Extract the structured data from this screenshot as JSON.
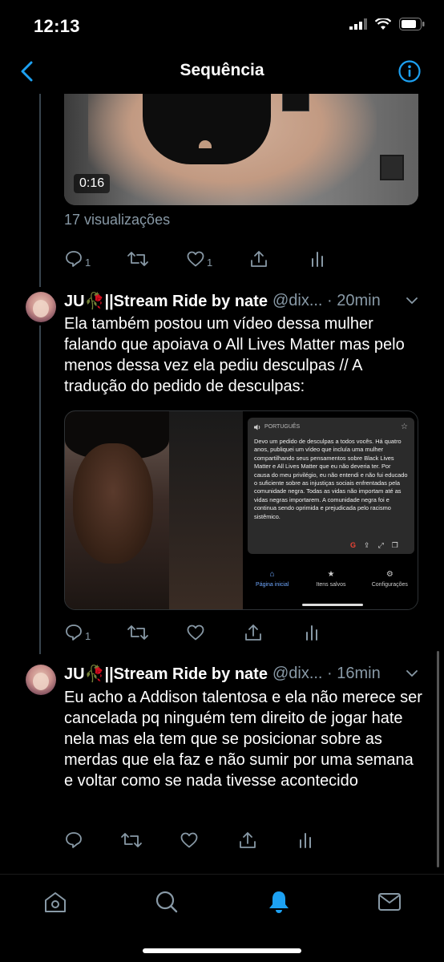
{
  "status_bar": {
    "time": "12:13"
  },
  "nav": {
    "title": "Sequência"
  },
  "tweet0": {
    "video_duration": "0:16",
    "views": "17 visualizações",
    "actions": {
      "reply_count": "1",
      "retweet_count": "",
      "like_count": "1"
    }
  },
  "tweet1": {
    "name": "JU🥀||Stream Ride by nate",
    "handle": "@dix... · 20min",
    "text": "Ela também postou um vídeo dessa mulher falando que apoiava o All Lives Matter mas pelo menos dessa vez ela pediu desculpas // A tradução do pedido de desculpas:",
    "image": {
      "language": "PORTUGUÊS",
      "translation": "Devo um pedido de desculpas a todos vocês. Há quatro anos, publiquei um vídeo que incluía uma mulher compartilhando seus pensamentos sobre Black Lives Matter e All Lives Matter que eu não deveria ter. Por causa do meu privilégio, eu não entendi e não fui educado o suficiente sobre as injustiças sociais enfrentadas pela comunidade negra. Todas as vidas não importam até as vidas negras importarem. A comunidade negra foi e continua sendo oprimida e prejudicada pelo racismo sistêmico.",
      "nav": [
        "Página inicial",
        "Itens salvos",
        "Configurações"
      ]
    },
    "actions": {
      "reply_count": "1"
    }
  },
  "tweet2": {
    "name": "JU🥀||Stream Ride by nate",
    "handle": "@dix... · 16min",
    "text": "Eu acho a Addison talentosa e ela não merece ser cancelada pq ninguém tem direito de jogar hate nela mas ela tem que se posicionar sobre as merdas que ela faz e não sumir por uma semana e voltar como se nada tivesse acontecido"
  },
  "colors": {
    "accent": "#1da1f2",
    "muted": "#8899a6",
    "line": "#38444d"
  },
  "tab_bar": {
    "icons": [
      "home-icon",
      "search-icon",
      "notifications-icon",
      "messages-icon"
    ],
    "active": "notifications-icon"
  }
}
